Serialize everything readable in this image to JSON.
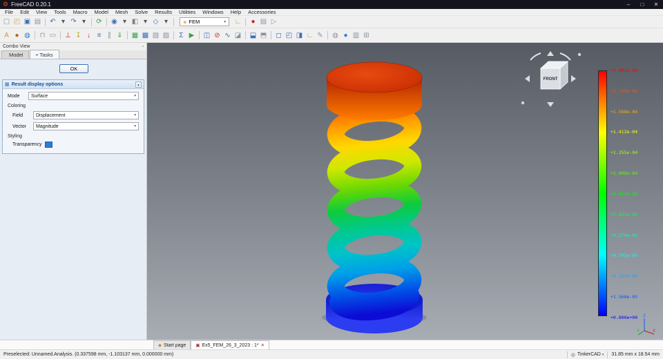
{
  "window": {
    "title": "FreeCAD 0.20.1"
  },
  "icons": {
    "app": "⚙",
    "minimize": "–",
    "maximize": "□",
    "close": "✕",
    "dock": "▫",
    "tasks_tab": "▸",
    "model_tab": "◈",
    "panel": "▦",
    "collapse": "▴",
    "combo_caret": "▾",
    "wb_icon": "◈",
    "wb_caret": "▾",
    "nav_mouse": "◎"
  },
  "menubar": {
    "items": [
      "File",
      "Edit",
      "View",
      "Tools",
      "Macro",
      "Model",
      "Mesh",
      "Solve",
      "Results",
      "Utilities",
      "Windows",
      "Help",
      "Accessories"
    ]
  },
  "toolbar_main": {
    "left_icons": [
      {
        "name": "new-document-icon",
        "glyph": "▢",
        "color": "#8a93a3"
      },
      {
        "name": "open-document-icon",
        "glyph": "◰",
        "color": "#d9a33c"
      },
      {
        "name": "save-icon",
        "glyph": "▣",
        "color": "#3b6fb5"
      },
      {
        "name": "print-icon",
        "glyph": "▤",
        "color": "#8a93a3"
      },
      {
        "name": "toolbar-separator",
        "is_sep": true
      },
      {
        "name": "undo-icon",
        "glyph": "↶",
        "color": "#3b6fb5"
      },
      {
        "name": "undo-caret-icon",
        "glyph": "▾",
        "color": "#555555",
        "is_caret": true
      },
      {
        "name": "redo-icon",
        "glyph": "↷",
        "color": "#3b6fb5"
      },
      {
        "name": "redo-caret-icon",
        "glyph": "▾",
        "color": "#555555",
        "is_caret": true
      },
      {
        "name": "toolbar-separator",
        "is_sep": true
      },
      {
        "name": "refresh-icon",
        "glyph": "⟳",
        "color": "#3f9e4d"
      },
      {
        "name": "toolbar-separator",
        "is_sep": true
      },
      {
        "name": "fit-all-icon",
        "glyph": "◉",
        "color": "#3b6fb5"
      },
      {
        "name": "zoom-caret-icon",
        "glyph": "▾",
        "color": "#555555",
        "is_caret": true
      },
      {
        "name": "draw-style-icon",
        "glyph": "◧",
        "color": "#7a8390"
      },
      {
        "name": "draw-style-caret-icon",
        "glyph": "▾",
        "color": "#555555",
        "is_caret": true
      },
      {
        "name": "isometric-view-icon",
        "glyph": "◇",
        "color": "#3b6fb5"
      },
      {
        "name": "view-caret-icon",
        "glyph": "▾",
        "color": "#555555",
        "is_caret": true
      },
      {
        "name": "toolbar-separator",
        "is_sep": true
      }
    ],
    "workbench_selector": {
      "value": "FEM"
    },
    "right_icons": [
      {
        "name": "measure-icon",
        "glyph": "∟",
        "color": "#c9a227"
      },
      {
        "name": "toolbar-separator",
        "is_sep": true
      },
      {
        "name": "macro-record-icon",
        "glyph": "●",
        "color": "#cc2222"
      },
      {
        "name": "macro-edit-icon",
        "glyph": "▤",
        "color": "#8a93a3"
      },
      {
        "name": "macro-play-icon",
        "glyph": "▷",
        "color": "#8a93a3"
      }
    ]
  },
  "toolbar_fem": {
    "icons": [
      {
        "name": "fem-analysis-icon",
        "glyph": "A",
        "color": "#c9a227"
      },
      {
        "name": "fem-material-solid-icon",
        "glyph": "●",
        "color": "#b5651d"
      },
      {
        "name": "fem-material-fluid-icon",
        "glyph": "◍",
        "color": "#2e7dd1"
      },
      {
        "name": "toolbar-separator",
        "is_sep": true
      },
      {
        "name": "fem-beam-section-icon",
        "glyph": "⊓",
        "color": "#8a93a3"
      },
      {
        "name": "fem-shell-thickness-icon",
        "glyph": "▭",
        "color": "#8a93a3"
      },
      {
        "name": "toolbar-separator",
        "is_sep": true
      },
      {
        "name": "fem-constraint-fixed-icon",
        "glyph": "⊥",
        "color": "#c23030"
      },
      {
        "name": "fem-constraint-displacement-icon",
        "glyph": "↧",
        "color": "#c9a227"
      },
      {
        "name": "fem-constraint-force-icon",
        "glyph": "↓",
        "color": "#c23030"
      },
      {
        "name": "fem-constraint-pressure-icon",
        "glyph": "≡",
        "color": "#3b6fb5"
      },
      {
        "name": "fem-constraint-contact-icon",
        "glyph": "∥",
        "color": "#8a93a3"
      },
      {
        "name": "fem-constraint-selfweight-icon",
        "glyph": "⇓",
        "color": "#3f9e4d"
      },
      {
        "name": "toolbar-separator",
        "is_sep": true
      },
      {
        "name": "fem-mesh-gmsh-icon",
        "glyph": "▦",
        "color": "#3f9e4d"
      },
      {
        "name": "fem-mesh-netgen-icon",
        "glyph": "▩",
        "color": "#3b6fb5"
      },
      {
        "name": "fem-mesh-region-icon",
        "glyph": "▧",
        "color": "#8a93a3"
      },
      {
        "name": "fem-mesh-group-icon",
        "glyph": "▨",
        "color": "#8a93a3"
      },
      {
        "name": "toolbar-separator",
        "is_sep": true
      },
      {
        "name": "fem-solver-calculix-icon",
        "glyph": "Σ",
        "color": "#3b6fb5"
      },
      {
        "name": "fem-solver-run-icon",
        "glyph": "▶",
        "color": "#3f9e4d"
      },
      {
        "name": "toolbar-separator",
        "is_sep": true
      },
      {
        "name": "fem-results-show-icon",
        "glyph": "◫",
        "color": "#3b6fb5"
      },
      {
        "name": "fem-results-purge-icon",
        "glyph": "⊘",
        "color": "#c23030"
      },
      {
        "name": "fem-post-pipeline-icon",
        "glyph": "∿",
        "color": "#3b6fb5"
      },
      {
        "name": "fem-post-clip-icon",
        "glyph": "◪",
        "color": "#8a93a3"
      },
      {
        "name": "toolbar-separator",
        "is_sep": true
      },
      {
        "name": "clipping-plane-icon",
        "glyph": "⬓",
        "color": "#3b6fb5"
      },
      {
        "name": "persistent-section-icon",
        "glyph": "⬒",
        "color": "#8a93a3"
      },
      {
        "name": "toolbar-separator",
        "is_sep": true
      },
      {
        "name": "view-front-icon",
        "glyph": "◻",
        "color": "#3b6fb5"
      },
      {
        "name": "view-top-icon",
        "glyph": "◰",
        "color": "#3b6fb5"
      },
      {
        "name": "view-right-icon",
        "glyph": "◨",
        "color": "#3b6fb5"
      },
      {
        "name": "measure-distance-icon",
        "glyph": "∟",
        "color": "#c9a227"
      },
      {
        "name": "annotation-icon",
        "glyph": "✎",
        "color": "#8a93a3"
      },
      {
        "name": "toolbar-separator",
        "is_sep": true
      },
      {
        "name": "scene-inspector-icon",
        "glyph": "◍",
        "color": "#8a93a3"
      },
      {
        "name": "web-sphere-icon",
        "glyph": "●",
        "color": "#2e7dd1"
      },
      {
        "name": "dock-overlay-icon",
        "glyph": "▥",
        "color": "#8a93a3"
      },
      {
        "name": "fullscreen-icon",
        "glyph": "⊞",
        "color": "#8a93a3"
      }
    ]
  },
  "combo_view": {
    "title": "Combo View",
    "tabs": [
      {
        "name": "tab-model",
        "label": "Model",
        "active": false
      },
      {
        "name": "tab-tasks",
        "label": "Tasks",
        "active": true,
        "icon": "▸"
      }
    ],
    "ok_label": "OK",
    "panel": {
      "title": "Result display options",
      "mode_label": "Mode",
      "mode_value": "Surface",
      "coloring_label": "Coloring",
      "field_label": "Field",
      "field_value": "Displacement",
      "vector_label": "Vector",
      "vector_value": "Magnitude",
      "styling_label": "Styling",
      "transparency_label": "Transparency"
    }
  },
  "viewport": {
    "nav_cube": {
      "front_label": "FRONT"
    },
    "axis": {
      "x": "X",
      "y": "Y",
      "z": "Z"
    },
    "legend": {
      "labels": [
        {
          "text": "+1.882e-04",
          "color": "#ff0000"
        },
        {
          "text": "+1.725e-04",
          "color": "#ff5500"
        },
        {
          "text": "+1.568e-04",
          "color": "#ffaa00"
        },
        {
          "text": "+1.412e-04",
          "color": "#ffff00"
        },
        {
          "text": "+1.255e-04",
          "color": "#aaff00"
        },
        {
          "text": "+1.098e-04",
          "color": "#55ff00"
        },
        {
          "text": "+9.411e-05",
          "color": "#00ff00"
        },
        {
          "text": "+7.842e-05",
          "color": "#00ff55"
        },
        {
          "text": "+6.274e-05",
          "color": "#00ffaa"
        },
        {
          "text": "+4.705e-05",
          "color": "#00ffff"
        },
        {
          "text": "+3.137e-05",
          "color": "#00aaff"
        },
        {
          "text": "+1.568e-05",
          "color": "#0055ff"
        },
        {
          "text": "+0.000e+00",
          "color": "#0000ff"
        }
      ]
    }
  },
  "document_tabs": [
    {
      "name": "tab-start-page",
      "label": "Start page",
      "icon": "◆",
      "icon_color": "#d9842c",
      "active": false,
      "close": ""
    },
    {
      "name": "tab-fem-document",
      "label": "Ex5_FEM_26_3_2023 : 1*",
      "icon": "▣",
      "icon_color": "#b03030",
      "active": true,
      "close": "✕"
    }
  ],
  "statusbar": {
    "left": "Preselected: Unnamed.Analysis. (0.337598 mm, -1.103137 mm, 0.000000 mm)",
    "nav_style": "TinkerCAD",
    "dimensions": "31.85 mm x 18.54 mm"
  }
}
